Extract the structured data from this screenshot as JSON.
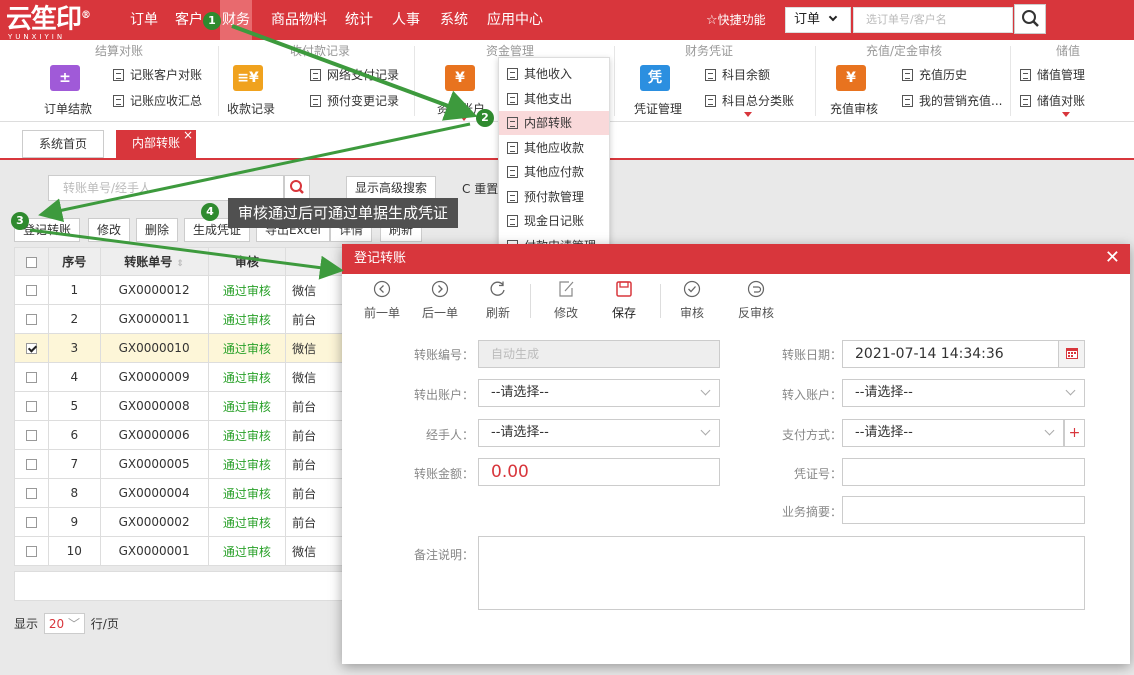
{
  "brand": {
    "logo_text": "云笙印",
    "logo_reg": "®",
    "logo_sub": "YUNXIYIN"
  },
  "top_nav": {
    "orders": "订单",
    "customers": "客户",
    "finance": "财务",
    "products": "商品物料",
    "stats": "统计",
    "hr": "人事",
    "system": "系统",
    "app_center": "应用中心",
    "quick": "快捷功能",
    "order_select": "订单",
    "search_placeholder": "选订单号/客户名"
  },
  "ribbon": {
    "g1": {
      "title": "结算对账",
      "big": "订单结款",
      "items": [
        "记账客户对账",
        "记账应收汇总"
      ]
    },
    "g2": {
      "title": "收付款记录",
      "big": "收款记录",
      "items": [
        "网络支付记录",
        "预付变更记录"
      ]
    },
    "g3": {
      "title": "资金管理",
      "big": "资金账户"
    },
    "g4": {
      "title": "财务凭证",
      "big": "凭证管理",
      "items": [
        "科目余额",
        "科目总分类账"
      ]
    },
    "g5": {
      "title": "充值/定金审核",
      "big": "充值审核",
      "items": [
        "充值历史",
        "我的营销充值..."
      ]
    },
    "g6": {
      "title": "储值",
      "items": [
        "储值管理",
        "储值对账"
      ]
    }
  },
  "tabs": {
    "home": "系统首页",
    "current": "内部转账"
  },
  "toolbar": {
    "search_placeholder": "转账单号/经手人",
    "advanced": "显示高级搜索",
    "reset": "重置",
    "register": "登记转账",
    "edit": "修改",
    "delete": "删除",
    "gen_voucher": "生成凭证",
    "export": "导出Excel",
    "detail": "详情",
    "refresh": "刷新"
  },
  "table": {
    "headers": {
      "seq": "序号",
      "no": "转账单号",
      "review": "审核"
    },
    "rows": [
      {
        "seq": "1",
        "no": "GX0000012",
        "review": "通过审核",
        "channel": "微信",
        "checked": false
      },
      {
        "seq": "2",
        "no": "GX0000011",
        "review": "通过审核",
        "channel": "前台",
        "checked": false
      },
      {
        "seq": "3",
        "no": "GX0000010",
        "review": "通过审核",
        "channel": "微信",
        "checked": true
      },
      {
        "seq": "4",
        "no": "GX0000009",
        "review": "通过审核",
        "channel": "微信",
        "checked": false
      },
      {
        "seq": "5",
        "no": "GX0000008",
        "review": "通过审核",
        "channel": "前台",
        "checked": false
      },
      {
        "seq": "6",
        "no": "GX0000006",
        "review": "通过审核",
        "channel": "前台",
        "checked": false
      },
      {
        "seq": "7",
        "no": "GX0000005",
        "review": "通过审核",
        "channel": "前台",
        "checked": false
      },
      {
        "seq": "8",
        "no": "GX0000004",
        "review": "通过审核",
        "channel": "前台",
        "checked": false
      },
      {
        "seq": "9",
        "no": "GX0000002",
        "review": "通过审核",
        "channel": "前台",
        "checked": false
      },
      {
        "seq": "10",
        "no": "GX0000001",
        "review": "通过审核",
        "channel": "微信",
        "checked": false
      }
    ]
  },
  "pager": {
    "show": "显示",
    "size": "20",
    "unit": "行/页"
  },
  "dropdown": {
    "items": [
      "其他收入",
      "其他支出",
      "内部转账",
      "其他应收款",
      "其他应付款",
      "预付款管理",
      "现金日记账",
      "付款申请管理"
    ],
    "highlighted": 2
  },
  "tooltip": "审核通过后可通过单据生成凭证",
  "badges": [
    "1",
    "2",
    "3",
    "4"
  ],
  "modal": {
    "title": "登记转账",
    "toolbar": [
      "前一单",
      "后一单",
      "刷新",
      "修改",
      "保存",
      "审核",
      "反审核"
    ],
    "labels": {
      "transfer_no": "转账编号",
      "transfer_date": "转账日期",
      "out_account": "转出账户",
      "in_account": "转入账户",
      "handler": "经手人",
      "pay_method": "支付方式",
      "amount": "转账金额",
      "voucher_no": "凭证号",
      "summary": "业务摘要",
      "remark": "备注说明"
    },
    "values": {
      "transfer_no": "自动生成",
      "transfer_date": "2021-07-14 14:34:36",
      "select": "--请选择--",
      "amount": "0.00"
    }
  },
  "colors": {
    "brand_red": "#d8363c",
    "approved_green": "#2aa12a",
    "badge_green": "#2f8a2f",
    "arrow_green": "#3d9a3d"
  }
}
